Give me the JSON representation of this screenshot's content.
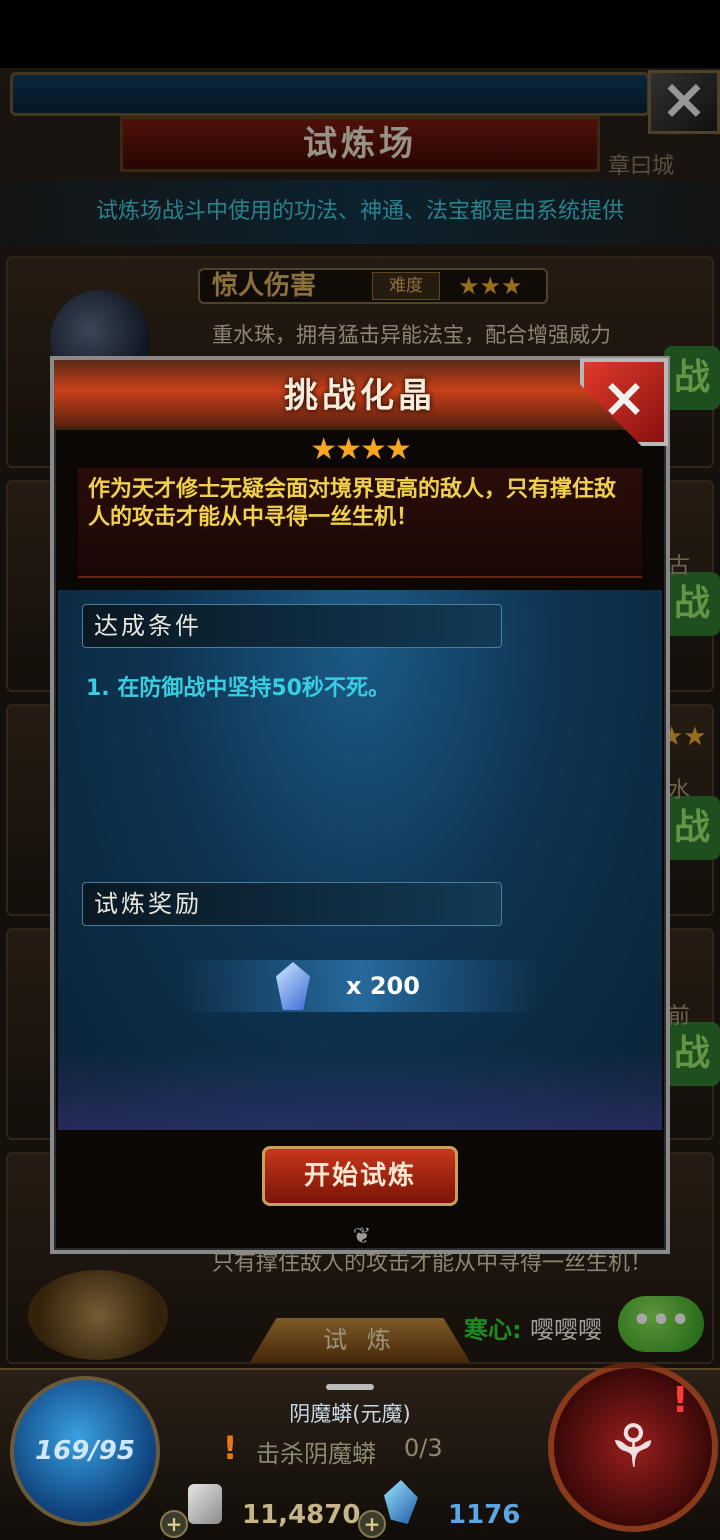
{
  "background": {
    "title": "试炼场",
    "close_icon": "×",
    "side_label": "章曰城",
    "notice": "试炼场战斗中使用的功法、神通、法宝都是由系统提供",
    "card": {
      "title": "惊人伤害",
      "difficulty_label": "难度",
      "stars": "★★★",
      "description": "重水珠，拥有猛击异能法宝，配合增强威力"
    },
    "challenge_glyph": "战",
    "right_stars": "★★",
    "side_texts": [
      "古",
      "水",
      "前"
    ],
    "bottom_description": "只有撑住敌人的攻击才能从中寻得一丝生机！",
    "tab_label": "试 炼",
    "chat": {
      "name": "寒心:",
      "message": "嘤嘤嘤",
      "bubble_icon": "•••"
    }
  },
  "hud": {
    "level_text": "169/95",
    "quest_title": "阴魔蟒(元魔)",
    "quest_icon": "!",
    "quest_text": "击杀阴魔蟒",
    "quest_progress": "0/3",
    "plus_icon": "+",
    "currency1": "11,4870",
    "currency2": "1176",
    "compass_glyph": "⚘",
    "alert_icon": "!"
  },
  "dialog": {
    "title": "挑战化晶",
    "close_icon": "×",
    "stars": "★★★★",
    "description": "作为天才修士无疑会面对境界更高的敌人，只有撑住敌人的攻击才能从中寻得一丝生机！",
    "conditions_label": "达成条件",
    "condition_text": "1. 在防御战中坚持50秒不死。",
    "rewards_label": "试炼奖励",
    "reward_icon": "crystal-icon",
    "reward_quantity": "x 200",
    "start_button": "开始试炼",
    "ornament": "❦"
  }
}
